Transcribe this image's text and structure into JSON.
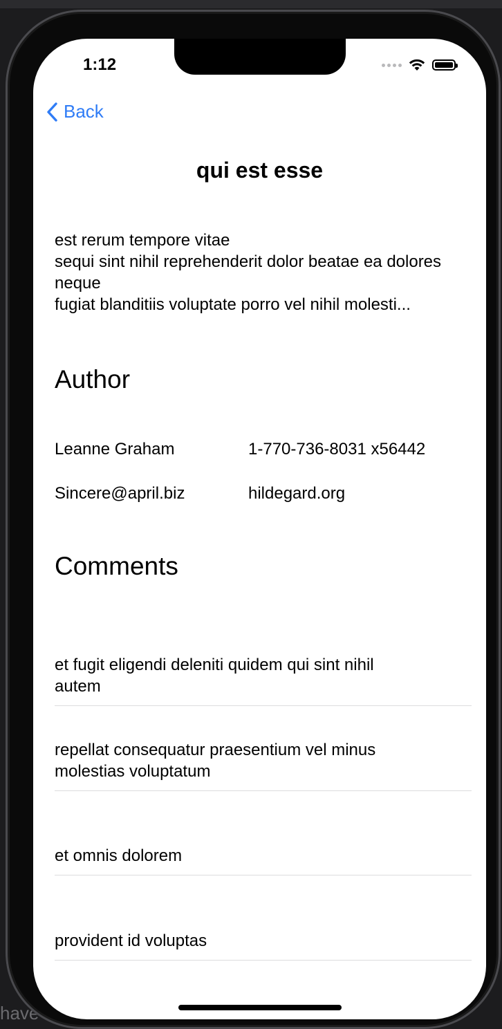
{
  "status_bar": {
    "time": "1:12"
  },
  "nav": {
    "back_label": "Back"
  },
  "post": {
    "title": "qui est esse",
    "body": "est rerum tempore vitae\nsequi sint nihil reprehenderit dolor beatae ea dolores neque\nfugiat blanditiis voluptate porro vel nihil molesti..."
  },
  "author": {
    "heading": "Author",
    "name": "Leanne Graham",
    "phone": "1-770-736-8031 x56442",
    "email": "Sincere@april.biz",
    "website": "hildegard.org"
  },
  "comments": {
    "heading": "Comments",
    "items": [
      {
        "title": "et fugit eligendi deleniti quidem qui sint nihil autem"
      },
      {
        "title": "repellat consequatur praesentium vel minus molestias voluptatum"
      },
      {
        "title": "et omnis dolorem"
      },
      {
        "title": "provident id voluptas"
      }
    ]
  },
  "background": {
    "partial_text": "have"
  },
  "colors": {
    "accent": "#2f7cf6",
    "separator": "#dcdcde",
    "frame": "#0a0a0a"
  },
  "icons": [
    "chevron-left-icon",
    "cellular-signal-icon",
    "wifi-icon",
    "battery-icon"
  ]
}
